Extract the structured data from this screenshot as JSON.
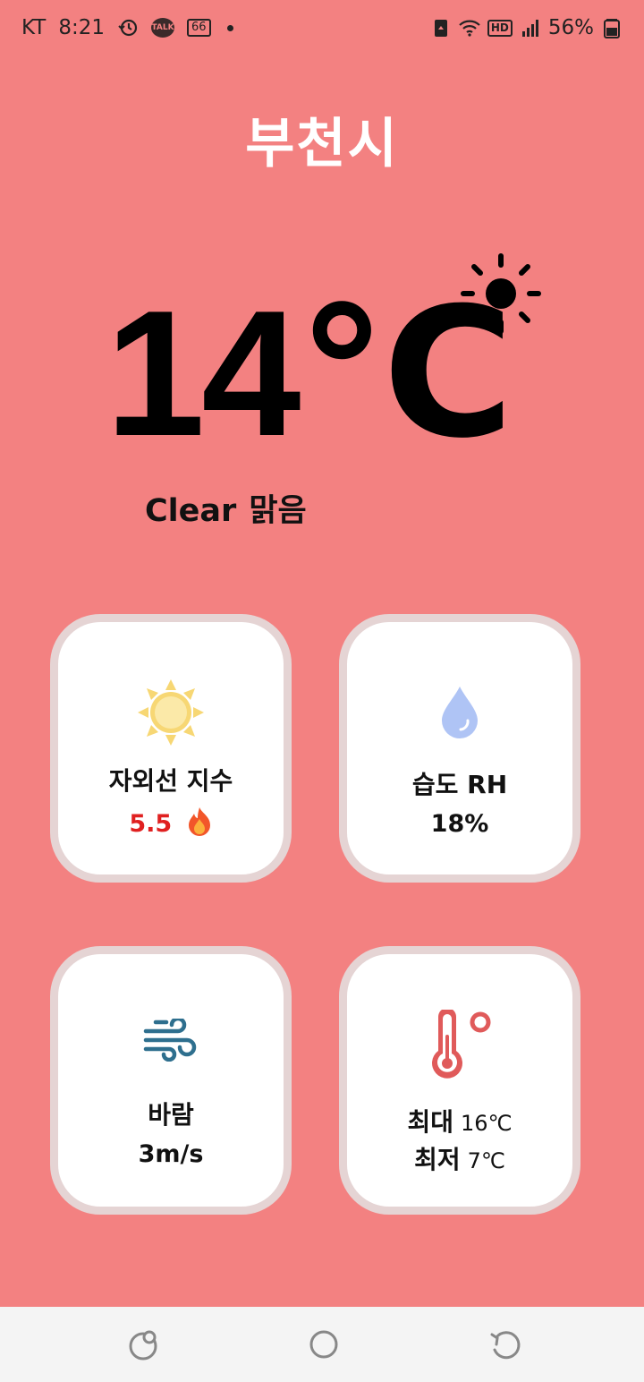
{
  "status_bar": {
    "carrier": "KT",
    "time": "8:21",
    "talk_badge": "TALK",
    "notif_count": "66",
    "battery": "56%",
    "network_badge": "HD",
    "icons": [
      "alarm-history-icon",
      "kakaotalk-icon",
      "message-count-icon",
      "recycle-icon",
      "wifi-icon",
      "hd-voice-icon",
      "signal-icon",
      "battery-icon"
    ]
  },
  "header": {
    "city": "부천시",
    "temperature": "14℃",
    "condition_en": "Clear",
    "condition_ko": "맑음",
    "condition_icon": "sun-icon"
  },
  "cards": {
    "uv": {
      "label": "자외선 지수",
      "value": "5.5",
      "icon": "sun-icon",
      "flag_icon": "fire-icon"
    },
    "humidity": {
      "label": "습도 RH",
      "value": "18%",
      "icon": "water-drop-icon"
    },
    "wind": {
      "label": "바람",
      "value": "3m/s",
      "icon": "wind-icon"
    },
    "temp_range": {
      "icon": "thermometer-icon",
      "max_label": "최대",
      "max_value": "16℃",
      "min_label": "최저",
      "min_value": "7℃"
    }
  },
  "colors": {
    "background": "#F38181",
    "card": "#FFFFFF",
    "card_border": "#E5D4D4",
    "uv_value": "#E02020",
    "wind_icon": "#2E6F8E",
    "thermometer": "#E05A5A",
    "drop": "#AFC4F5"
  },
  "nav_bar": {
    "buttons": [
      "recent-apps-icon",
      "home-icon",
      "back-icon"
    ]
  }
}
